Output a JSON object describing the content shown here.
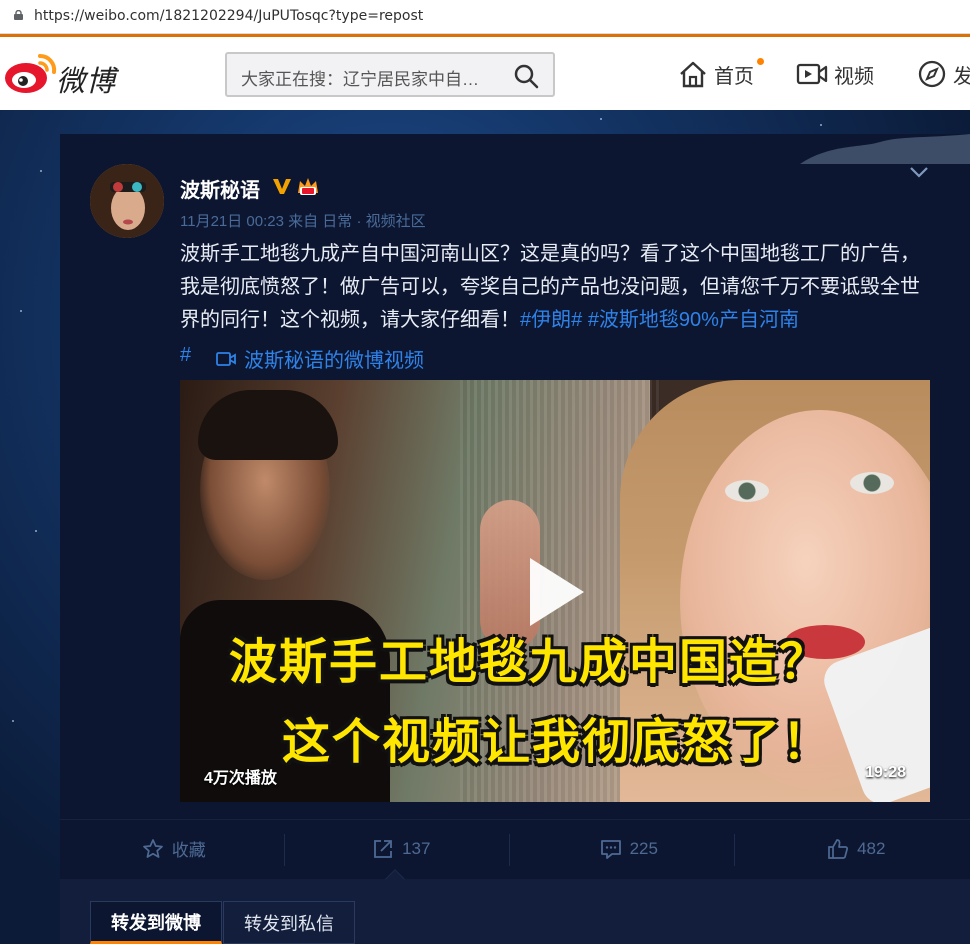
{
  "browser": {
    "url": "https://weibo.com/1821202294/JuPUTosqc?type=repost"
  },
  "header": {
    "logo_text": "微博",
    "search_placeholder": "大家正在搜：辽宁居民家中自…",
    "nav": [
      {
        "label": "首页",
        "icon": "home-icon"
      },
      {
        "label": "视频",
        "icon": "video-icon"
      },
      {
        "label": "发",
        "icon": "compass-icon"
      }
    ],
    "accent_color": "#ff8200"
  },
  "post": {
    "username": "波斯秘语",
    "meta": "11月21日 00:23 来自 日常 · 视频社区",
    "text": "波斯手工地毯九成产自中国河南山区？这是真的吗？看了这个中国地毯工厂的广告，我是彻底愤怒了！做广告可以，夸奖自己的产品也没问题，但请您千万不要诋毁全世界的同行！这个视频，请大家仔细看！",
    "topic1": "#伊朗#",
    "topic2": "#波斯地毯90%产自河南",
    "topic2_tail": "#",
    "video_link": "波斯秘语的微博视频",
    "link_color": "#2f82e8",
    "video": {
      "caption_line1": "波斯手工地毯九成中国造？",
      "caption_line2": "这个视频让我彻底怒了！",
      "views": "4万次播放",
      "duration": "19:28"
    },
    "actions": {
      "favorite": "收藏",
      "repost": "137",
      "comment": "225",
      "like": "482"
    },
    "repost_tabs": {
      "to_weibo": "转发到微博",
      "to_dm": "转发到私信"
    }
  }
}
